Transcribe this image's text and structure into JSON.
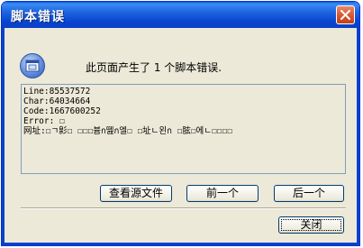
{
  "window": {
    "title": "脚本错误"
  },
  "message": "此页面产生了 1 个脚本错误.",
  "details": {
    "lines": [
      "Line:85537572",
      "Char:64034664",
      "Code:1667600252",
      "Error: ☐",
      "网址:☐ㄱ㣐☐  ☐☐☐븀ก뗊ก엘☐  ☐址ㄴ왼ก  ☐胘☐에ㄴ☐☐☐☐"
    ]
  },
  "buttons": {
    "view_source": "查看源文件",
    "previous": "前一个",
    "next": "后一个",
    "close": "关闭"
  },
  "icons": {
    "title_close": "close-icon",
    "info": "info-icon"
  }
}
